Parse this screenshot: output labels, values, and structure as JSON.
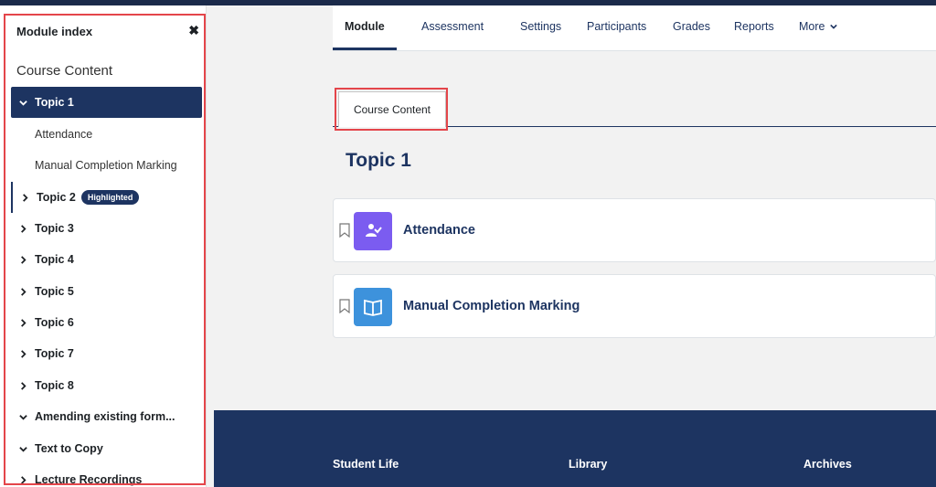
{
  "drawer": {
    "title": "Module index",
    "close_glyph": "✖",
    "course_heading": "Course Content",
    "items": [
      {
        "label": "Topic 1",
        "expanded": true,
        "active": true
      },
      {
        "label": "Attendance",
        "child": true
      },
      {
        "label": "Manual Completion Marking",
        "child": true
      },
      {
        "label": "Topic 2",
        "badge": "Highlighted"
      },
      {
        "label": "Topic 3"
      },
      {
        "label": "Topic 4"
      },
      {
        "label": "Topic 5"
      },
      {
        "label": "Topic 6"
      },
      {
        "label": "Topic 7"
      },
      {
        "label": "Topic 8"
      },
      {
        "label": "Amending existing form...",
        "expanded": true
      },
      {
        "label": "Text to Copy",
        "expanded": true
      },
      {
        "label": "Lecture Recordings"
      }
    ]
  },
  "nav": {
    "tabs": [
      "Module",
      "Assessment",
      "Settings",
      "Participants",
      "Grades",
      "Reports",
      "More"
    ],
    "active": "Module"
  },
  "content": {
    "section_tab": "Course Content",
    "topic_title": "Topic 1",
    "activities": [
      {
        "name": "Attendance",
        "icon": "attendance-icon",
        "color": "#7b5cf0"
      },
      {
        "name": "Manual Completion Marking",
        "icon": "book-icon",
        "color": "#3d92dc"
      }
    ]
  },
  "footer": {
    "links": [
      "Student Life",
      "Library",
      "Archives"
    ]
  },
  "colors": {
    "brand": "#1d3461",
    "highlight_frame": "#e4454a"
  }
}
